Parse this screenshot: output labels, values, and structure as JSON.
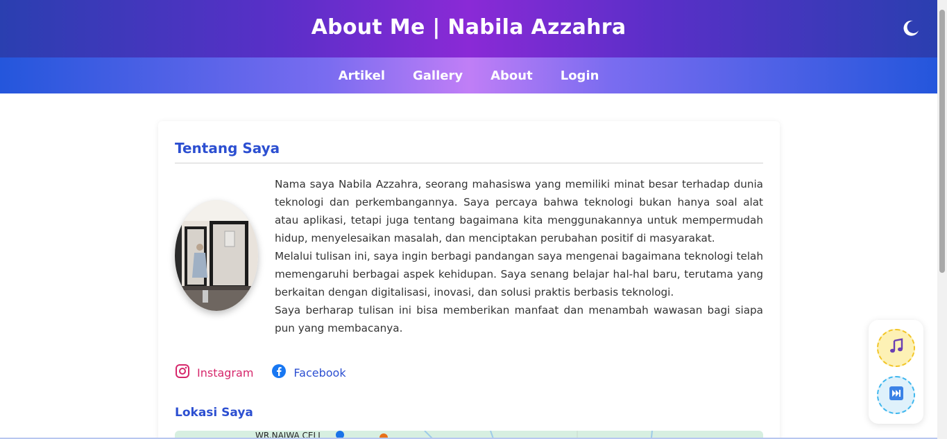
{
  "header": {
    "title": "About Me | Nabila Azzahra"
  },
  "nav": {
    "items": [
      "Artikel",
      "Gallery",
      "About",
      "Login"
    ]
  },
  "about": {
    "title": "Tentang Saya",
    "paragraphs": [
      "Nama saya Nabila Azzahra, seorang mahasiswa yang memiliki minat besar terhadap dunia teknologi dan perkembangannya. Saya percaya bahwa teknologi bukan hanya soal alat atau aplikasi, tetapi juga tentang bagaimana kita menggunakannya untuk mempermudah hidup, menyelesaikan masalah, dan menciptakan perubahan positif di masyarakat.",
      "Melalui tulisan ini, saya ingin berbagi pandangan saya mengenai bagaimana teknologi telah memengaruhi berbagai aspek kehidupan. Saya senang belajar hal-hal baru, terutama yang berkaitan dengan digitalisasi, inovasi, dan solusi praktis berbasis teknologi.",
      "Saya berharap tulisan ini bisa memberikan manfaat dan menambah wawasan bagi siapa pun yang membacanya."
    ]
  },
  "socials": {
    "instagram": "Instagram",
    "facebook": "Facebook"
  },
  "location": {
    "title": "Lokasi Saya",
    "map_label": "WR.NAJWA CELL"
  },
  "colors": {
    "accent": "#2c4fd1",
    "instagram": "#d6276b"
  },
  "icons": [
    "moon-icon",
    "instagram-icon",
    "facebook-icon",
    "music-note-icon",
    "fast-forward-icon"
  ]
}
